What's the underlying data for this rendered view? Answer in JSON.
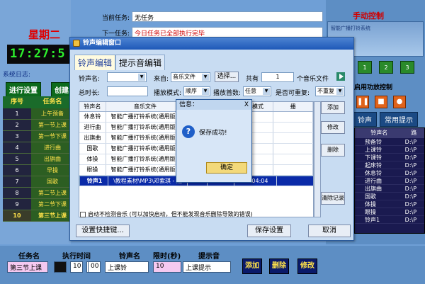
{
  "main": {
    "weekday": "星期二",
    "clock": "17:27:5",
    "syslog_label": "系统日志:",
    "btn_schedule": "进行设置",
    "btn_create": "创建",
    "current_task_label": "当前任务:",
    "current_task_value": "无任务",
    "next_task_label": "下一任务:",
    "next_task_value": "今日任务已全部执行完毕"
  },
  "task_table": {
    "headers": [
      "序号",
      "任务名"
    ],
    "rows": [
      {
        "num": "1",
        "name": "上午预备"
      },
      {
        "num": "2",
        "name": "第一节上课"
      },
      {
        "num": "3",
        "name": "第一节下课"
      },
      {
        "num": "4",
        "name": "进行曲"
      },
      {
        "num": "5",
        "name": "出旗曲"
      },
      {
        "num": "6",
        "name": "早操"
      },
      {
        "num": "7",
        "name": "国歌"
      },
      {
        "num": "8",
        "name": "第二节上课"
      },
      {
        "num": "9",
        "name": "第二节下课"
      },
      {
        "num": "10",
        "name": "第三节上课"
      }
    ]
  },
  "right_panel": {
    "title": "手动控制",
    "banner_text": "智能广播打铃系统",
    "mini_buttons": [
      "1",
      "2",
      "3"
    ],
    "enable_label": "启用功放控制",
    "tab_ring": "铃声",
    "tab_common": "常用提示",
    "list_headers": [
      "铃声名",
      "路"
    ],
    "list_rows": [
      {
        "name": "预备铃",
        "path": "D:\\P"
      },
      {
        "name": "上课铃",
        "path": "D:\\P"
      },
      {
        "name": "下课铃",
        "path": "D:\\P"
      },
      {
        "name": "起床铃",
        "path": "D:\\P"
      },
      {
        "name": "休息铃",
        "path": "D:\\P"
      },
      {
        "name": "进行曲",
        "path": "D:\\P"
      },
      {
        "name": "出旗曲",
        "path": "D:\\P"
      },
      {
        "name": "国歌",
        "path": "D:\\P"
      },
      {
        "name": "体操",
        "path": "D:\\P"
      },
      {
        "name": "眼操",
        "path": "D:\\P"
      },
      {
        "name": "铃声1",
        "path": "D:\\P"
      }
    ]
  },
  "bottom": {
    "task_name_label": "任务名",
    "task_name_value": "第三节上课",
    "exec_time_label": "执行时间",
    "hh": "10",
    "mm": "10",
    "ss": "00",
    "ring_label": "铃声名",
    "ring_value": "上课铃",
    "limit_label": "限时(秒)",
    "limit_value": "10",
    "prompt_label": "提示音",
    "prompt_value": "上课提示",
    "add": "添加",
    "delete": "删除",
    "modify": "修改"
  },
  "dialog": {
    "title": "铃声编辑窗口",
    "tab_ring_edit": "铃声编辑",
    "tab_prompt_edit": "提示音编辑",
    "ring_name_label": "铃声名:",
    "source_label": "来自:",
    "source_value": "音乐文件",
    "choose": "选择...",
    "total_label": "共有",
    "total_value": "1",
    "file_unit": "个音乐文件",
    "duration_label": "总时长:",
    "mode_label": "播放模式:",
    "mode_value": "顺序",
    "count_label": "播放首数:",
    "count_value": "任意",
    "repeat_label": "是否可重复:",
    "repeat_value": "不重复",
    "grid_headers": [
      "铃声名",
      "音乐文件",
      "",
      "",
      "播放模式",
      "播"
    ],
    "grid_rows": [
      {
        "c1": "休息铃",
        "c2": "智能广播打铃系统(通用版)\\",
        "c3": "",
        "c4": "",
        "c5": "",
        "c6": ""
      },
      {
        "c1": "进行曲",
        "c2": "智能广播打铃系统(通用版)\\",
        "c3": "",
        "c4": "",
        "c5": "",
        "c6": ""
      },
      {
        "c1": "出旗曲",
        "c2": "智能广播打铃系统(通用版)\\",
        "c3": "",
        "c4": "",
        "c5": "",
        "c6": ""
      },
      {
        "c1": "国歌",
        "c2": "智能广播打铃系统(通用版)\\",
        "c3": "",
        "c4": "",
        "c5": "",
        "c6": ""
      },
      {
        "c1": "体操",
        "c2": "智能广播打铃系统(通用版)\\",
        "c3": "",
        "c4": "",
        "c5": "",
        "c6": ""
      },
      {
        "c1": "眼操",
        "c2": "智能广播打铃系统(通用版)\\",
        "c3": "",
        "c4": "",
        "c5": "",
        "c6": ""
      }
    ],
    "selected_row": {
      "c1": "铃声1",
      "c2": "\\教程素材\\MP3\\邓紫琪 - 泡",
      "c3": "1",
      "c4": "",
      "c5": "00:04:04",
      "c6": ""
    },
    "btn_add": "添加",
    "btn_modify": "修改",
    "btn_delete": "删除",
    "btn_clear": "清除记录",
    "checkbox_text": "启动不检测音乐 (可以加快启动，但不能发现音乐删除导致的错误)",
    "btn_shortcut": "设置快捷键...",
    "btn_save": "保存设置",
    "btn_cancel": "取消"
  },
  "info_dialog": {
    "title": "信息：",
    "message": "保存成功!",
    "ok": "确定",
    "close": "X"
  }
}
